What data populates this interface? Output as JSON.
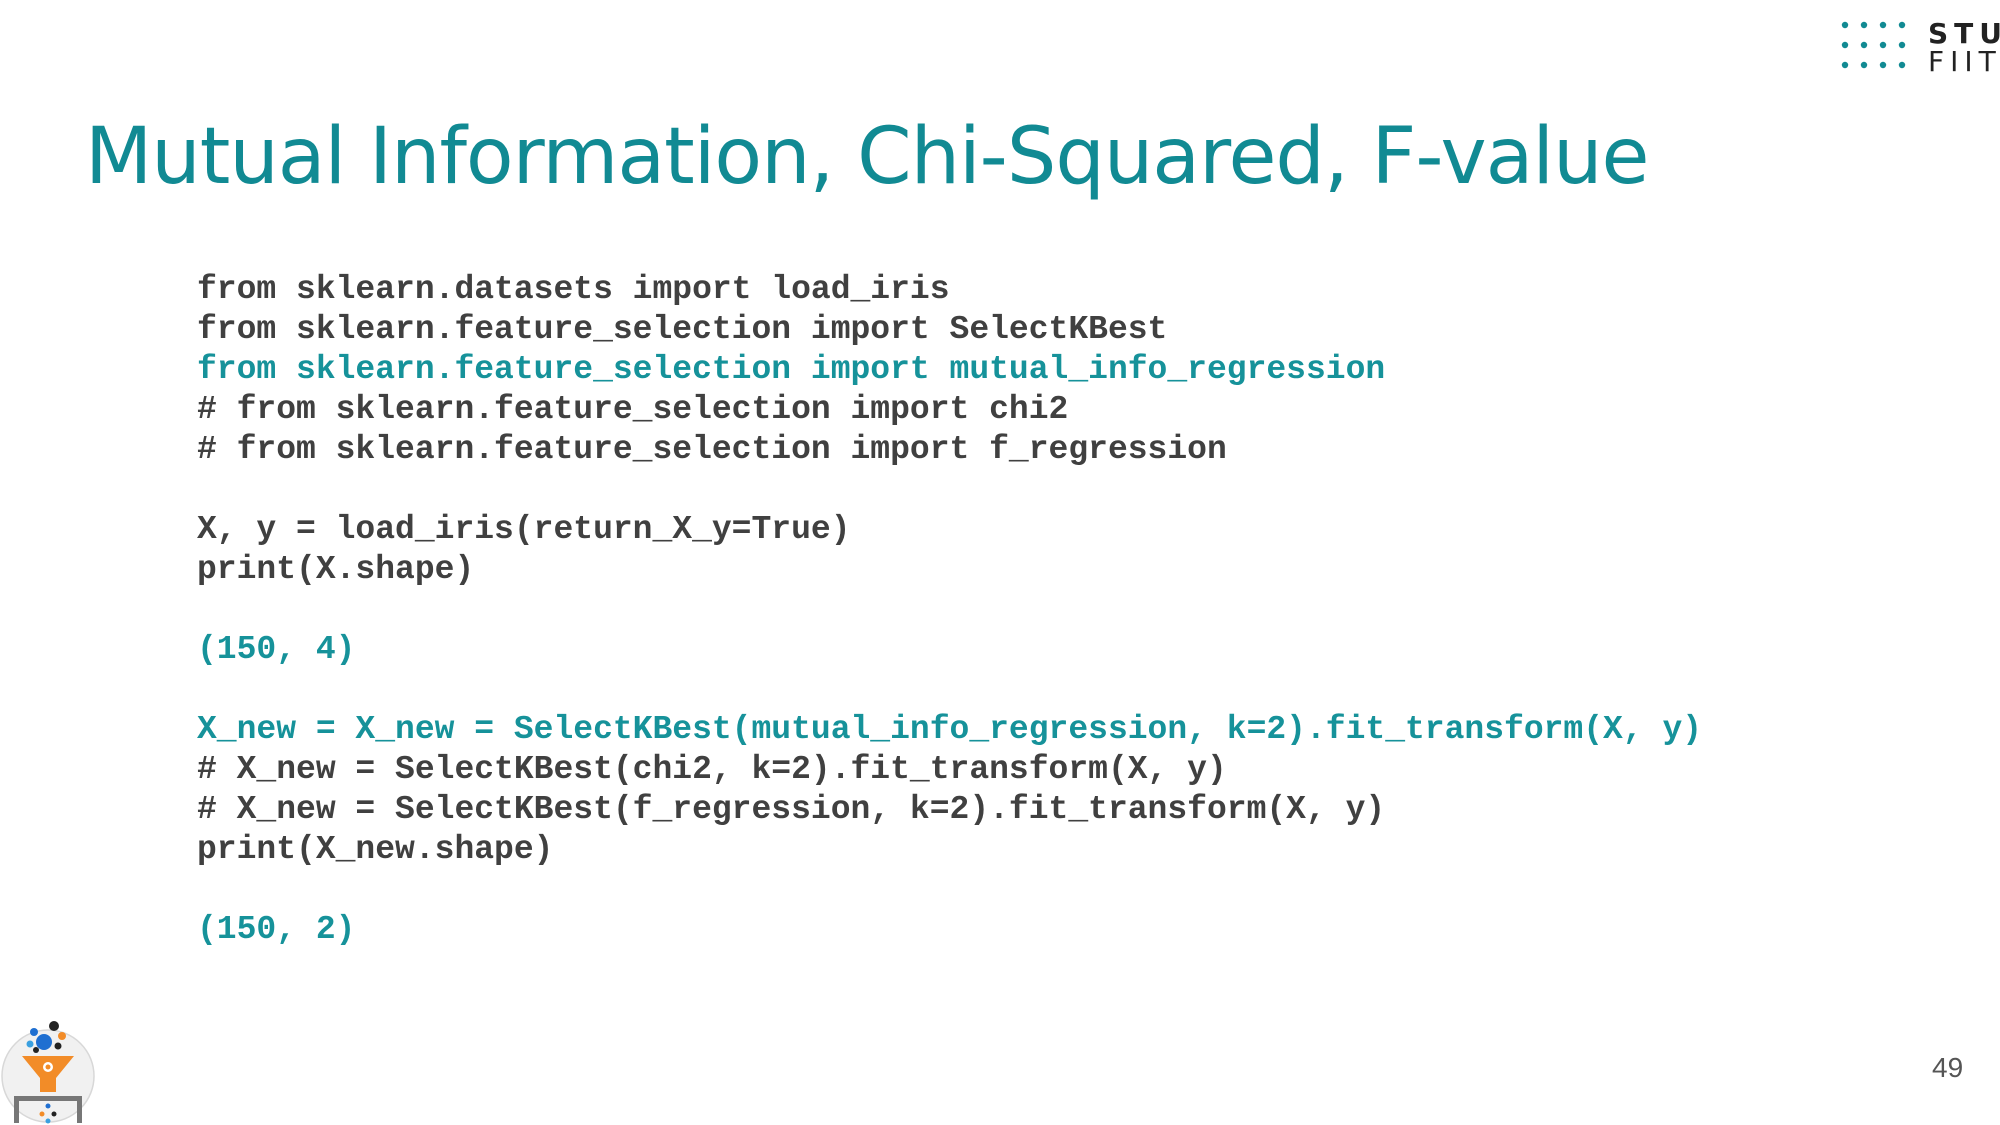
{
  "slide": {
    "title": "Mutual Information, Chi-Squared, F-value",
    "page_number": "49"
  },
  "logo": {
    "line1": "STU",
    "line2": "FIIT"
  },
  "code": {
    "lines": [
      {
        "text": "from sklearn.datasets import load_iris",
        "highlight": false
      },
      {
        "text": "from sklearn.feature_selection import SelectKBest",
        "highlight": false
      },
      {
        "text": "from sklearn.feature_selection import mutual_info_regression",
        "highlight": true
      },
      {
        "text": "# from sklearn.feature_selection import chi2",
        "highlight": false
      },
      {
        "text": "# from sklearn.feature_selection import f_regression",
        "highlight": false
      },
      {
        "text": "",
        "highlight": false
      },
      {
        "text": "X, y = load_iris(return_X_y=True)",
        "highlight": false
      },
      {
        "text": "print(X.shape)",
        "highlight": false
      },
      {
        "text": "",
        "highlight": false
      },
      {
        "text": "(150, 4)",
        "highlight": true
      },
      {
        "text": "",
        "highlight": false
      },
      {
        "text": "X_new = X_new = SelectKBest(mutual_info_regression, k=2).fit_transform(X, y)",
        "highlight": true
      },
      {
        "text": "# X_new = SelectKBest(chi2, k=2).fit_transform(X, y)",
        "highlight": false
      },
      {
        "text": "# X_new = SelectKBest(f_regression, k=2).fit_transform(X, y)",
        "highlight": false
      },
      {
        "text": "print(X_new.shape)",
        "highlight": false
      },
      {
        "text": "",
        "highlight": false
      },
      {
        "text": "(150, 2)",
        "highlight": true
      }
    ]
  },
  "colors": {
    "accent": "#118a93",
    "code_default": "#404040",
    "code_highlight": "#16929a"
  }
}
